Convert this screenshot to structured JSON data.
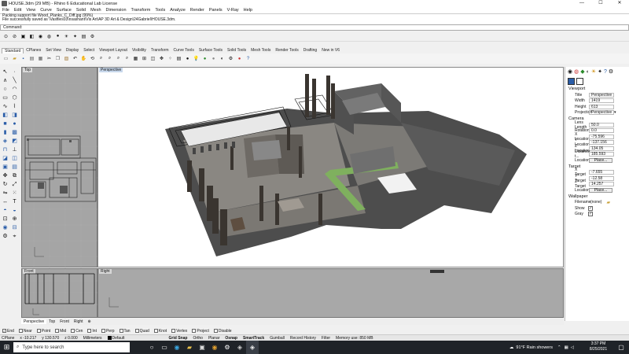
{
  "window": {
    "title": "HOUSE.3dm (29 MB) - Rhino 6 Educational Lab License",
    "min": "—",
    "max": "☐",
    "close": "✕"
  },
  "menu": [
    "File",
    "Edit",
    "View",
    "Curve",
    "Surface",
    "Solid",
    "Mesh",
    "Dimension",
    "Transform",
    "Tools",
    "Analyze",
    "Render",
    "Panels",
    "V-Ray",
    "Help"
  ],
  "command_history": [
    "Packing support file Wood_Planks_C_Diff.jpg (99%)",
    "File successfully saved as \\Vasfiles03\\nsashant\\Vis Art\\AP 3D Art & Design\\24Gabriel\\HOUSE.3dm."
  ],
  "command_prompt": "Command:",
  "toolbar_tabs": [
    "Standard",
    "CPlanes",
    "Set View",
    "Display",
    "Select",
    "Viewport Layout",
    "Visibility",
    "Transform",
    "Curve Tools",
    "Surface Tools",
    "Solid Tools",
    "Mesh Tools",
    "Render Tools",
    "Drafting",
    "New in V6"
  ],
  "viewports": {
    "top": "Top",
    "perspective": "Perspective",
    "front": "Front",
    "right": "Right"
  },
  "viewport_tabs": [
    "Perspective",
    "Top",
    "Front",
    "Right"
  ],
  "properties": {
    "viewport_header": "Viewport",
    "rows": [
      {
        "label": "Title",
        "value": "Perspective"
      },
      {
        "label": "Width",
        "value": "1419"
      },
      {
        "label": "Height",
        "value": "613"
      },
      {
        "label": "Projection",
        "value": "Perspective"
      }
    ],
    "camera_header": "Camera",
    "camera": [
      {
        "label": "Lens Length",
        "value": "50.0"
      },
      {
        "label": "Rotation",
        "value": "0.0"
      },
      {
        "label": "X Location",
        "value": "-75.596"
      },
      {
        "label": "Y Location",
        "value": "-137.156"
      },
      {
        "label": "Z Location",
        "value": "134.05"
      },
      {
        "label": "Distance t...",
        "value": "185.593"
      }
    ],
    "location_label": "Location",
    "place_label": "Place...",
    "target_header": "Target",
    "target": [
      {
        "label": "X Target",
        "value": "-7.655"
      },
      {
        "label": "Y Target",
        "value": "-12.58"
      },
      {
        "label": "Z Target",
        "value": "14.257"
      }
    ],
    "wallpaper_header": "Wallpaper",
    "filename_label": "Filename",
    "filename_value": "(none)",
    "show_label": "Show",
    "gray_label": "Gray"
  },
  "osnaps": [
    "End",
    "Near",
    "Point",
    "Mid",
    "Cen",
    "Int",
    "Perp",
    "Tan",
    "Quad",
    "Knot",
    "Vertex",
    "Project",
    "Disable"
  ],
  "osnap_checked": [
    true,
    false,
    false,
    false,
    false,
    false,
    false,
    false,
    false,
    false,
    false,
    false,
    false
  ],
  "status": {
    "cplane": "CPlane",
    "x": "x -10.217",
    "y": "y 130.570",
    "z": "z 0.000",
    "units": "Millimeters",
    "layer": "Default",
    "grid_snap": "Grid Snap",
    "ortho": "Ortho",
    "planar": "Planar",
    "osnap": "Osnap",
    "smarttrack": "SmartTrack",
    "gumball": "Gumball",
    "record_history": "Record History",
    "filter": "Filter",
    "memory": "Memory use: 850 MB"
  },
  "taskbar": {
    "search_placeholder": "Type here to search",
    "weather": "91°F  Rain showers",
    "time": "3:37 PM",
    "date": "8/25/2021"
  }
}
